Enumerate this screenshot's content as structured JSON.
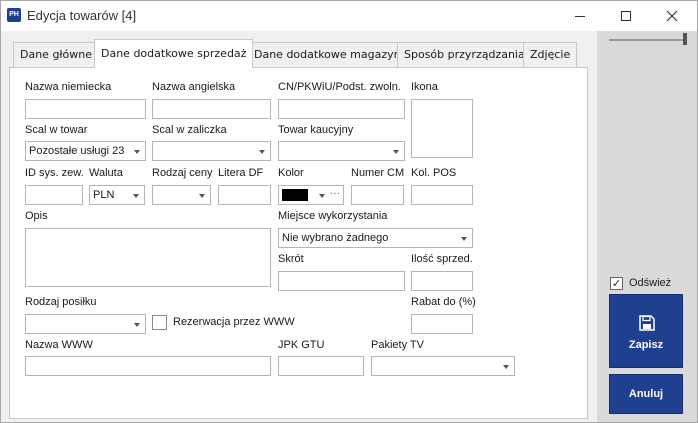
{
  "window": {
    "icon_text": "PH",
    "title": "Edycja towarów [4]"
  },
  "tabs": [
    {
      "label": "Dane główne"
    },
    {
      "label": "Dane dodatkowe sprzedaż"
    },
    {
      "label": "Dane dodatkowe magazyn"
    },
    {
      "label": "Sposób przyrządzania"
    },
    {
      "label": "Zdjęcie"
    }
  ],
  "form": {
    "nazwa_niemiecka": {
      "label": "Nazwa niemiecka",
      "value": ""
    },
    "nazwa_angielska": {
      "label": "Nazwa angielska",
      "value": ""
    },
    "cn": {
      "label": "CN/PKWiU/Podst. zwoln.",
      "value": ""
    },
    "ikona": {
      "label": "Ikona"
    },
    "scal_w_towar": {
      "label": "Scal w towar",
      "value": "Pozostałe usługi 23"
    },
    "scal_w_zaliczka": {
      "label": "Scal w zaliczka",
      "value": ""
    },
    "towar_kaucyjny": {
      "label": "Towar kaucyjny",
      "value": ""
    },
    "id_sys_zew": {
      "label": "ID sys. zew.",
      "value": ""
    },
    "waluta": {
      "label": "Waluta",
      "value": "PLN"
    },
    "rodzaj_ceny": {
      "label": "Rodzaj ceny",
      "value": ""
    },
    "litera_df": {
      "label": "Litera DF",
      "value": ""
    },
    "kolor": {
      "label": "Kolor",
      "value": "#000000",
      "dots": "···"
    },
    "numer_cm": {
      "label": "Numer CM",
      "value": ""
    },
    "kol_pos": {
      "label": "Kol. POS",
      "value": ""
    },
    "opis": {
      "label": "Opis",
      "value": ""
    },
    "miejsce_wykorzystania": {
      "label": "Miejsce wykorzystania",
      "value": "Nie wybrano żadnego"
    },
    "skrot": {
      "label": "Skrót",
      "value": ""
    },
    "ilosc_sprzed": {
      "label": "Ilość sprzed.",
      "value": ""
    },
    "rodzaj_posilku": {
      "label": "Rodzaj posiłku",
      "value": ""
    },
    "rezerwacja": {
      "label": "Rezerwacja przez WWW",
      "checked": false
    },
    "rabat_do": {
      "label": "Rabat do (%)",
      "value": ""
    },
    "nazwa_www": {
      "label": "Nazwa WWW",
      "value": ""
    },
    "jpk_gtu": {
      "label": "JPK GTU",
      "value": ""
    },
    "pakiety_tv": {
      "label": "Pakiety TV",
      "value": ""
    }
  },
  "side": {
    "refresh_label": "Odśwież",
    "refresh_checked": true,
    "save_label": "Zapisz",
    "cancel_label": "Anuluj"
  },
  "colors": {
    "accent": "#1f3f8f"
  }
}
